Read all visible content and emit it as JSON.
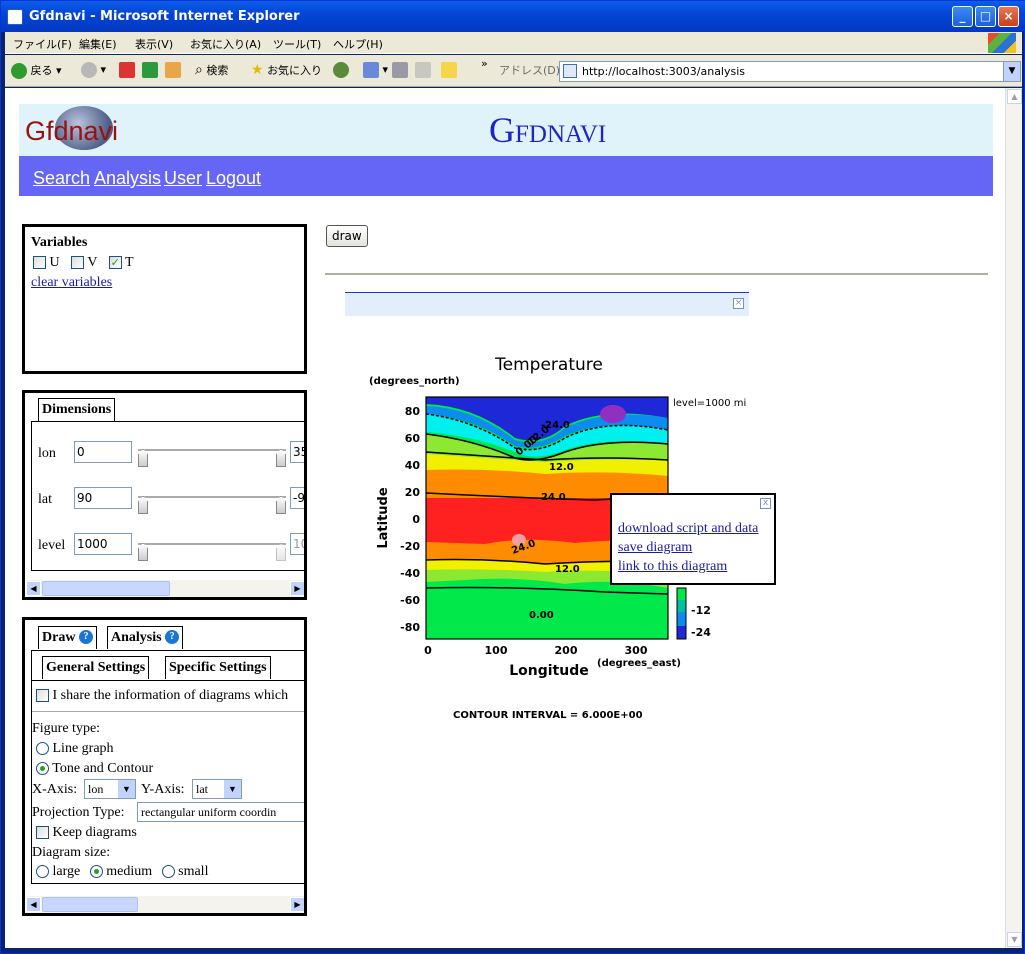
{
  "window": {
    "title": "Gfdnavi - Microsoft Internet Explorer",
    "menu": [
      "ファイル(F)",
      "編集(E)",
      "表示(V)",
      "お気に入り(A)",
      "ツール(T)",
      "ヘルプ(H)"
    ],
    "toolbar": {
      "back": "戻る",
      "search": "検索",
      "favorites": "お気に入り",
      "chevron": "»",
      "address_label": "アドレス(D)"
    },
    "address": "http://localhost:3003/analysis"
  },
  "header": {
    "logo": "Gfdnavi",
    "title": "Gfdnavi"
  },
  "nav": [
    "Search",
    "Analysis",
    "User",
    "Logout"
  ],
  "variables": {
    "title": "Variables",
    "items": [
      {
        "label": "U",
        "checked": false
      },
      {
        "label": "V",
        "checked": false
      },
      {
        "label": "T",
        "checked": true
      }
    ],
    "clear": "clear variables"
  },
  "dimensions": {
    "tab": "Dimensions",
    "rows": [
      {
        "name": "lon",
        "from": "0",
        "to": "35"
      },
      {
        "name": "lat",
        "from": "90",
        "to": "-9"
      },
      {
        "name": "level",
        "from": "1000",
        "to": "10"
      }
    ]
  },
  "draw_panel": {
    "tabs": [
      "Draw",
      "Analysis"
    ],
    "subtabs": [
      "General Settings",
      "Specific Settings"
    ],
    "share": "I share the information of diagrams which",
    "figure_type_label": "Figure type:",
    "figure_types": [
      {
        "label": "Line graph",
        "selected": false
      },
      {
        "label": "Tone and Contour",
        "selected": true
      }
    ],
    "x_axis_label": "X-Axis:",
    "x_axis": "lon",
    "y_axis_label": "Y-Axis:",
    "y_axis": "lat",
    "projection_label": "Projection Type:",
    "projection": "rectangular uniform coordin",
    "keep": "Keep diagrams",
    "size_label": "Diagram size:",
    "sizes": [
      {
        "label": "large",
        "selected": false
      },
      {
        "label": "medium",
        "selected": true
      },
      {
        "label": "small",
        "selected": false
      }
    ]
  },
  "draw_button": "draw",
  "plot": {
    "title": "Temperature",
    "ylabel": "Latitude",
    "xlabel": "Longitude",
    "yunit": "(degrees_north)",
    "xunit": "(degrees_east)",
    "level": "level=1000 mi",
    "yticks": [
      "80",
      "60",
      "40",
      "20",
      "0",
      "-20",
      "-40",
      "-60",
      "-80"
    ],
    "xticks": [
      "0",
      "100",
      "200",
      "300"
    ],
    "contour_labels": [
      "-24.0",
      "12.0",
      "0.00",
      "12.0",
      "24.0",
      "24.0",
      "12.0",
      "0.00"
    ],
    "colorbar_labels": [
      "-12",
      "-24"
    ],
    "footer": "CONTOUR INTERVAL = 6.000E+00"
  },
  "popup": {
    "close": "x",
    "links": [
      "download script and data",
      "save diagram",
      "link to this diagram"
    ]
  }
}
